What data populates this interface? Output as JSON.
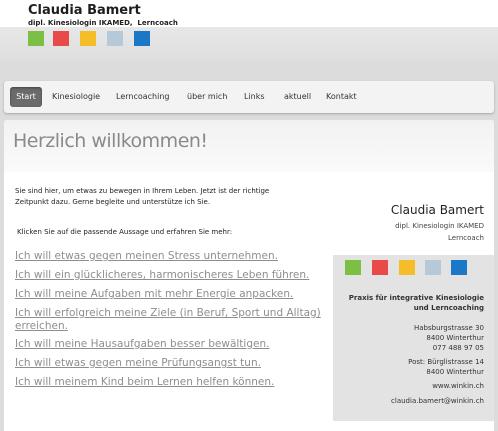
{
  "header": {
    "name": "Claudia Bamert",
    "subtitle": "dipl. Kinesiologin IKAMED,  Lerncoach",
    "swatches": [
      "#7bbf44",
      "#e84a4a",
      "#f6bd2a",
      "#b5c9d9",
      "#1b78c9"
    ]
  },
  "nav": {
    "items": [
      {
        "label": "Start",
        "active": true
      },
      {
        "label": "Kinesiologie",
        "active": false
      },
      {
        "label": "Lerncoaching",
        "active": false
      },
      {
        "label": "über mich",
        "active": false
      },
      {
        "label": "Links",
        "active": false
      },
      {
        "label": "aktuell",
        "active": false
      },
      {
        "label": "Kontakt",
        "active": false
      }
    ]
  },
  "main": {
    "heading": "Herzlich willkommen!",
    "intro": "Sie sind hier, um etwas zu bewegen in Ihrem Leben. Jetzt ist der richtige Zeitpunkt dazu. Gerne begleite und unterstütze ich Sie.",
    "prompt": "Klicken Sie auf die passende Aussage und erfahren Sie mehr:",
    "links": [
      "Ich will etwas gegen meinen Stress unternehmen.",
      "Ich will ein glücklicheres, harmonischeres Leben führen.",
      "Ich will meine Aufgaben mit mehr Energie anpacken.",
      "Ich will erfolgreich meine Ziele (in Beruf, Sport und Alltag) erreichen.",
      "Ich will meine Hausaufgaben besser bewältigen.",
      "Ich will etwas gegen meine Prüfungsangst tun.",
      "Ich will meinem Kind beim Lernen helfen können."
    ]
  },
  "card": {
    "name": "Claudia Bamert",
    "title": "dipl. Kinesiologin IKAMED",
    "role": "Lerncoach",
    "swatches": [
      "#7bbf44",
      "#e84a4a",
      "#f6bd2a",
      "#b5c9d9",
      "#1b78c9"
    ],
    "slogan": "Praxis für integrative Kinesiologie und Lerncoaching",
    "address1": "Habsburgstrasse 30",
    "city1": "8400 Winterthur",
    "phone": "077 488 97 05",
    "post": "Post: Bürglistrasse 14",
    "city2": "8400 Winterthur",
    "web": "www.winkin.ch",
    "email": "claudia.bamert@winkin.ch"
  }
}
